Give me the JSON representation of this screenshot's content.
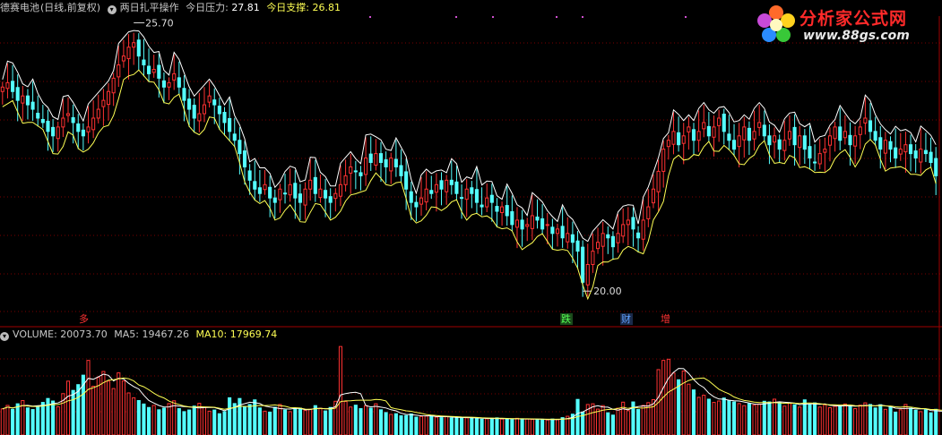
{
  "header": {
    "stock_name": "德赛电池",
    "period": "(日线,前复权)",
    "indicator_name": "两日扎平操作",
    "pressure_label": "今日压力:",
    "pressure_value": "27.81",
    "support_label": "今日支撑:",
    "support_value": "26.81"
  },
  "volume_header": {
    "label": "VOLUME:",
    "value": "20073.70",
    "ma5_label": "MA5:",
    "ma5_value": "19467.26",
    "ma10_label": "MA10:",
    "ma10_value": "17969.74"
  },
  "logo": {
    "title": "分析家公式网",
    "url": "www.88gs.com"
  },
  "colors": {
    "background": "#000000",
    "up": "#ff3232",
    "down": "#54ffff",
    "ma_white": "#ffffff",
    "ma_yellow": "#ffff54",
    "grid": "#7a0000",
    "separator": "#a00000",
    "header_text": "#c8c8c8",
    "pressure_text": "#ffffff",
    "support_text": "#ffff54"
  },
  "chart_data": [
    {
      "type": "candlestick",
      "title": "德赛电池 (日线,前复权)",
      "annotations": [
        {
          "text": "25.70",
          "kind": "high"
        },
        {
          "text": "20.00",
          "kind": "low"
        }
      ],
      "signals": [
        {
          "text": "多",
          "color": "#ff3232"
        },
        {
          "text": "跌",
          "color": "#54ff54"
        },
        {
          "text": "财",
          "color": "#5fa0ff"
        },
        {
          "text": "增",
          "color": "#ff3232"
        }
      ],
      "ylim": [
        19.5,
        26.2
      ],
      "close": [
        24.6,
        24.7,
        24.5,
        24.3,
        24.4,
        24.2,
        24.1,
        23.9,
        23.8,
        23.6,
        23.5,
        23.7,
        23.9,
        24.0,
        23.8,
        23.6,
        23.5,
        23.7,
        23.9,
        24.1,
        24.3,
        24.5,
        24.8,
        25.1,
        25.3,
        25.5,
        25.6,
        25.3,
        25.1,
        24.9,
        25.0,
        24.8,
        24.6,
        24.7,
        24.9,
        24.6,
        24.3,
        24.1,
        23.9,
        24.0,
        24.2,
        24.4,
        24.2,
        24.0,
        23.8,
        23.6,
        23.4,
        23.1,
        22.8,
        22.5,
        22.3,
        22.2,
        22.4,
        22.1,
        22.0,
        22.3,
        22.2,
        22.4,
        22.1,
        22.0,
        22.3,
        22.5,
        22.2,
        22.3,
        22.1,
        22.0,
        22.2,
        22.4,
        22.6,
        22.8,
        22.7,
        22.6,
        23.0,
        22.9,
        23.1,
        22.9,
        22.8,
        23.0,
        22.8,
        22.6,
        22.3,
        22.0,
        21.9,
        22.1,
        22.3,
        22.2,
        22.4,
        22.3,
        22.5,
        22.4,
        22.2,
        22.1,
        22.3,
        22.2,
        22.0,
        21.9,
        22.1,
        22.0,
        21.8,
        21.9,
        21.7,
        21.5,
        21.6,
        21.4,
        21.5,
        21.7,
        21.6,
        21.4,
        21.5,
        21.3,
        21.4,
        21.2,
        21.3,
        21.1,
        20.9,
        20.2,
        20.6,
        20.9,
        21.1,
        21.3,
        21.2,
        21.0,
        21.3,
        21.5,
        21.6,
        21.4,
        21.2,
        21.6,
        21.9,
        22.3,
        22.7,
        23.2,
        23.4,
        23.6,
        23.3,
        23.5,
        23.7,
        23.4,
        23.6,
        23.8,
        23.5,
        23.7,
        23.9,
        23.6,
        23.4,
        23.2,
        23.5,
        23.7,
        23.4,
        23.6,
        23.8,
        23.5,
        23.3,
        23.5,
        23.2,
        23.4,
        23.6,
        23.3,
        23.5,
        23.2,
        23.0,
        22.9,
        23.1,
        23.2,
        23.5,
        23.7,
        23.4,
        23.6,
        23.3,
        23.5,
        23.7,
        23.9,
        23.6,
        23.4,
        23.2,
        23.4,
        23.2,
        23.0,
        23.2,
        23.3,
        23.1,
        23.0,
        23.2,
        23.1,
        22.9,
        22.6
      ]
    },
    {
      "type": "bar",
      "title": "VOLUME",
      "ylim": [
        0,
        38000
      ],
      "series_names": [
        "MA5",
        "MA10"
      ],
      "values": [
        9000,
        10500,
        8800,
        11200,
        12600,
        9400,
        8700,
        10100,
        11800,
        13500,
        12400,
        9900,
        15600,
        21000,
        17000,
        19500,
        23600,
        30000,
        18800,
        22600,
        25200,
        21000,
        17800,
        24600,
        21100,
        15900,
        13800,
        12600,
        11100,
        9600,
        10500,
        8600,
        9300,
        11300,
        12500,
        9100,
        7800,
        8500,
        10200,
        11400,
        9700,
        8000,
        8500,
        6900,
        7800,
        13800,
        11300,
        13500,
        9800,
        10900,
        12900,
        9400,
        8000,
        7600,
        9700,
        10900,
        8500,
        7800,
        9200,
        9300,
        8300,
        8800,
        10400,
        9300,
        8100,
        9600,
        12300,
        36000,
        12200,
        9800,
        10600,
        9100,
        10400,
        9300,
        11200,
        8600,
        7400,
        6600,
        6900,
        6000,
        6100,
        6800,
        5400,
        5700,
        5900,
        6000,
        5400,
        5200,
        5600,
        5100,
        5300,
        5000,
        5100,
        5200,
        4800,
        4500,
        4700,
        4900,
        5100,
        4600,
        4500,
        4300,
        4900,
        4700,
        4600,
        4400,
        4300,
        4500,
        4200,
        4600,
        4300,
        5200,
        5800,
        6700,
        13100,
        7600,
        10900,
        11200,
        8900,
        10400,
        7300,
        6300,
        9300,
        11900,
        8200,
        12000,
        8700,
        10500,
        11700,
        13000,
        26000,
        30000,
        30500,
        24500,
        21600,
        25400,
        19700,
        17200,
        14000,
        14900,
        13200,
        11800,
        12400,
        13700,
        12600,
        12000,
        11300,
        10400,
        11200,
        10600,
        11100,
        12300,
        12000,
        13200,
        11700,
        10200,
        11500,
        10800,
        9800,
        12900,
        10800,
        11600,
        9800,
        10800,
        9500,
        10100,
        10500,
        11100,
        10100,
        9100,
        10600,
        11600,
        10900,
        9400,
        10800,
        8800,
        9900,
        7600,
        8600,
        10900,
        9300,
        8400,
        7800,
        8600,
        7300,
        8800,
        7400,
        7600,
        7200,
        8400
      ]
    }
  ]
}
